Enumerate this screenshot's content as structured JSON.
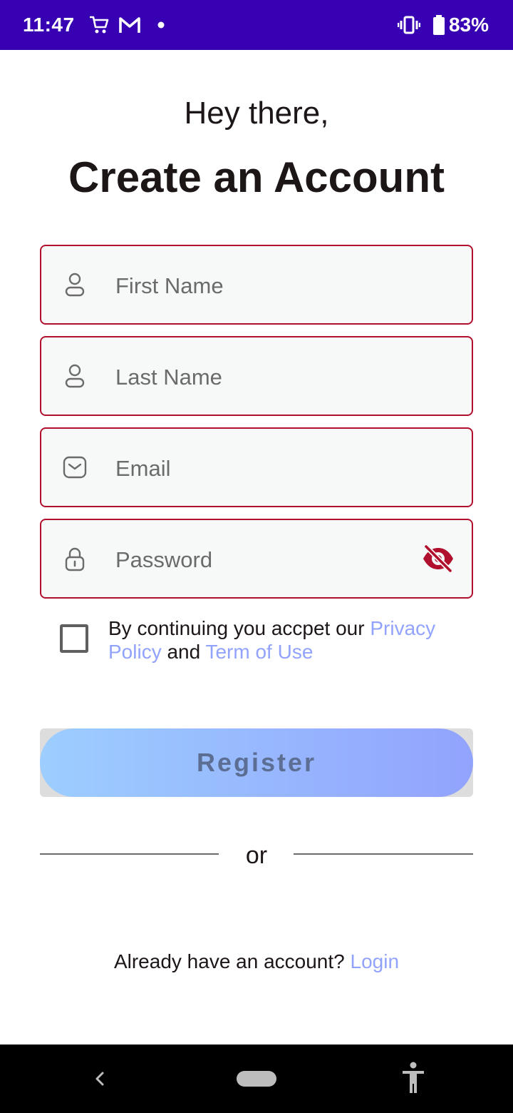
{
  "status_bar": {
    "time": "11:47",
    "battery": "83%",
    "icons": [
      "cart-icon",
      "gmail-icon",
      "dot-icon",
      "vibrate-icon",
      "battery-icon"
    ]
  },
  "header": {
    "greeting": "Hey there,",
    "title": "Create an Account"
  },
  "form": {
    "first_name": {
      "placeholder": "First Name",
      "icon": "person-icon"
    },
    "last_name": {
      "placeholder": "Last Name",
      "icon": "person-icon"
    },
    "email": {
      "placeholder": "Email",
      "icon": "mail-icon"
    },
    "password": {
      "placeholder": "Password",
      "icon": "lock-icon",
      "toggle_icon": "eye-off-icon"
    }
  },
  "terms": {
    "prefix": "By continuing you accpet our ",
    "privacy_link": "Privacy Policy",
    "middle": " and ",
    "terms_link": "Term of Use",
    "checked": false
  },
  "register": {
    "label": "Register"
  },
  "divider": {
    "text": "or"
  },
  "login": {
    "prompt": "Already have an account? ",
    "link": "Login"
  },
  "colors": {
    "status_bar": "#3700b3",
    "field_border": "#b0102e",
    "field_bg": "#f7f8f8",
    "link": "#92a3fd",
    "gradient_start": "#9dceff",
    "gradient_end": "#92a3fd"
  }
}
